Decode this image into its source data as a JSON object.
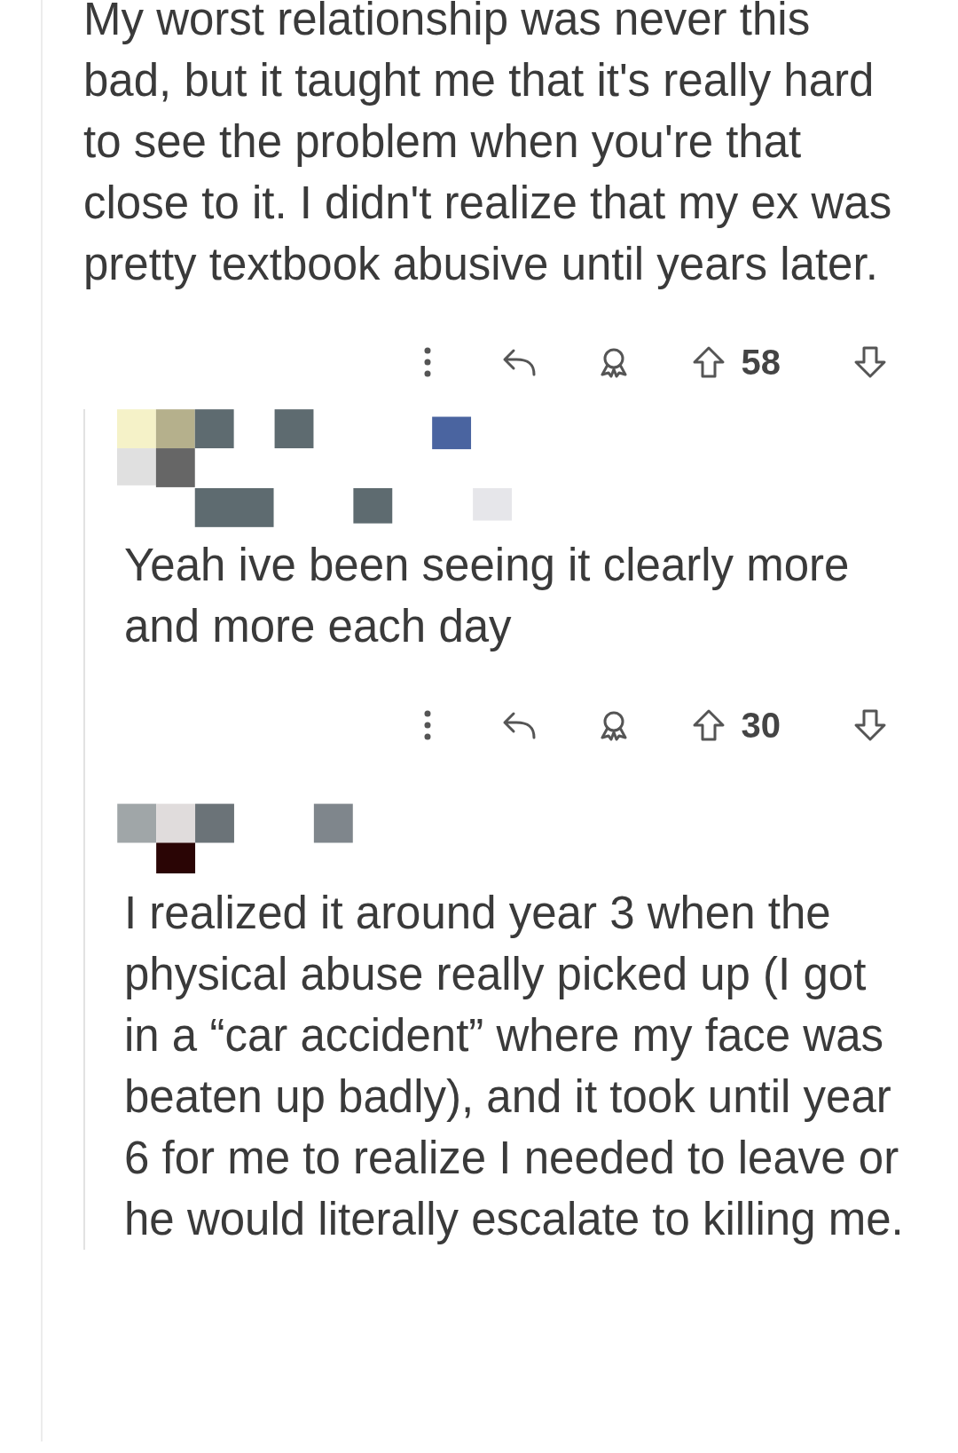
{
  "comment": {
    "body": "My worst relationship was never this bad, but it taught me that it's really hard to see the problem when you're that close to it. I didn't realize that my ex was pretty textbook abusive until years later.",
    "score": "58"
  },
  "replies": [
    {
      "body": "Yeah ive been seeing it clearly more and more each day",
      "score": "30"
    },
    {
      "body": "I realized it around year 3 when the physical abuse really picked up (I got in a “car accident” where my face was beaten up badly), and it took until year 6 for me to realize I needed to leave or he would literally escalate to killing me."
    }
  ]
}
